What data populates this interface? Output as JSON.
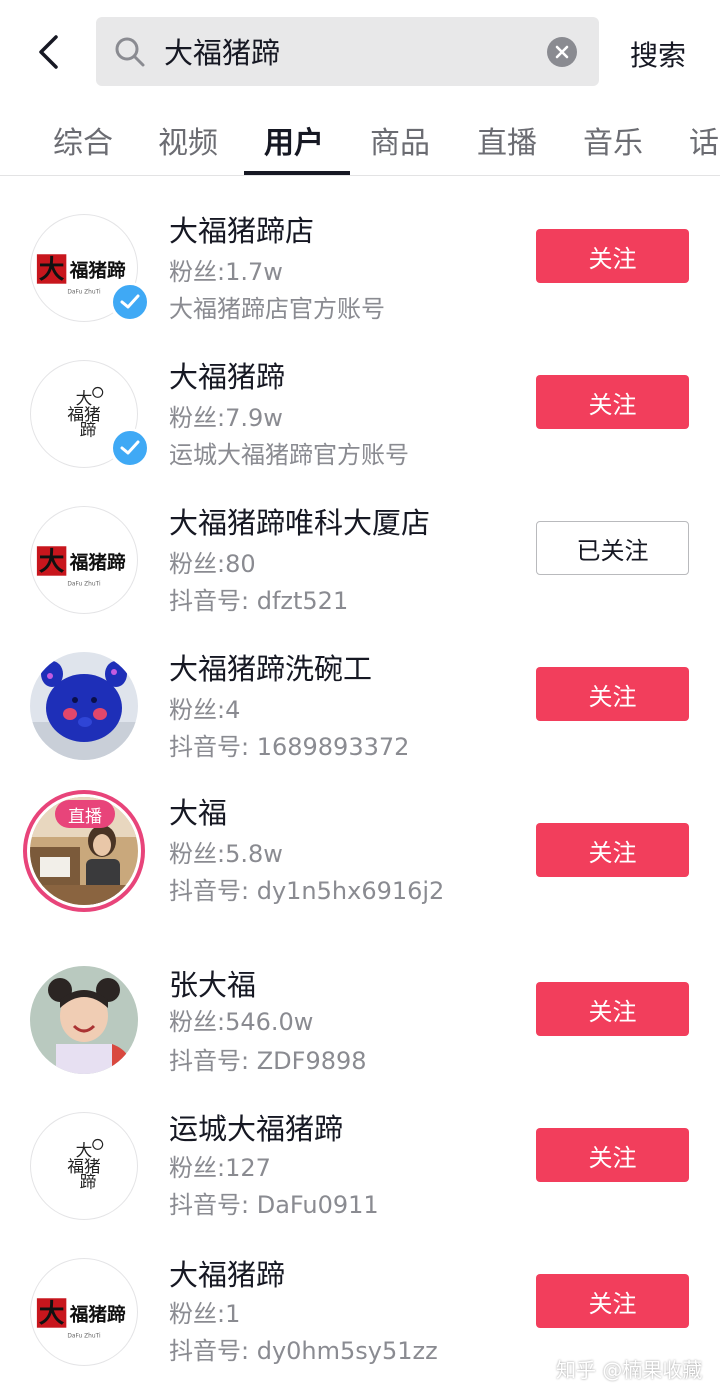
{
  "search": {
    "query": "大福猪蹄",
    "submit_label": "搜索"
  },
  "tabs": [
    {
      "label": "综合"
    },
    {
      "label": "视频"
    },
    {
      "label": "用户"
    },
    {
      "label": "商品"
    },
    {
      "label": "直播"
    },
    {
      "label": "音乐"
    },
    {
      "label": "话"
    }
  ],
  "active_tab": "用户",
  "users": [
    {
      "name": "大福猪蹄店",
      "fans": "粉丝:1.7w",
      "meta": "大福猪蹄店官方账号",
      "follow_label": "关注",
      "verified": true,
      "avatar": "logo-red"
    },
    {
      "name": "大福猪蹄",
      "fans": "粉丝:7.9w",
      "meta": "运城大福猪蹄官方账号",
      "follow_label": "关注",
      "verified": true,
      "avatar": "logo-vertical"
    },
    {
      "name": "大福猪蹄唯科大厦店",
      "fans": "粉丝:80",
      "meta": "抖音号: dfzt521",
      "follow_label": "已关注",
      "verified": false,
      "avatar": "logo-red"
    },
    {
      "name": "大福猪蹄洗碗工",
      "fans": "粉丝:4",
      "meta": "抖音号: 1689893372",
      "follow_label": "关注",
      "verified": false,
      "avatar": "octopus"
    },
    {
      "name": "大福",
      "fans": "粉丝:5.8w",
      "meta": "抖音号: dy1n5hx6916j2",
      "follow_label": "关注",
      "verified": false,
      "avatar": "photo-person",
      "live_label": "直播"
    },
    {
      "name": "张大福",
      "fans": "粉丝:546.0w",
      "meta": "抖音号: ZDF9898",
      "follow_label": "关注",
      "verified": false,
      "avatar": "photo-girl"
    },
    {
      "name": "运城大福猪蹄",
      "fans": "粉丝:127",
      "meta": "抖音号: DaFu0911",
      "follow_label": "关注",
      "verified": false,
      "avatar": "logo-vertical"
    },
    {
      "name": "大福猪蹄",
      "fans": "粉丝:1",
      "meta": "抖音号: dy0hm5sy51zz",
      "follow_label": "关注",
      "verified": false,
      "avatar": "logo-red"
    }
  ],
  "logo_text": {
    "big": "大",
    "rest": "福猪蹄",
    "vertical": [
      "大",
      "福猪",
      "蹄"
    ],
    "pinyin": "DaFu ZhuTi"
  },
  "watermark": "知乎 @楠果收藏",
  "colors": {
    "follow_red": "#f23e5c",
    "verified_blue": "#3fa9f5",
    "live_pink": "#e8447a"
  }
}
